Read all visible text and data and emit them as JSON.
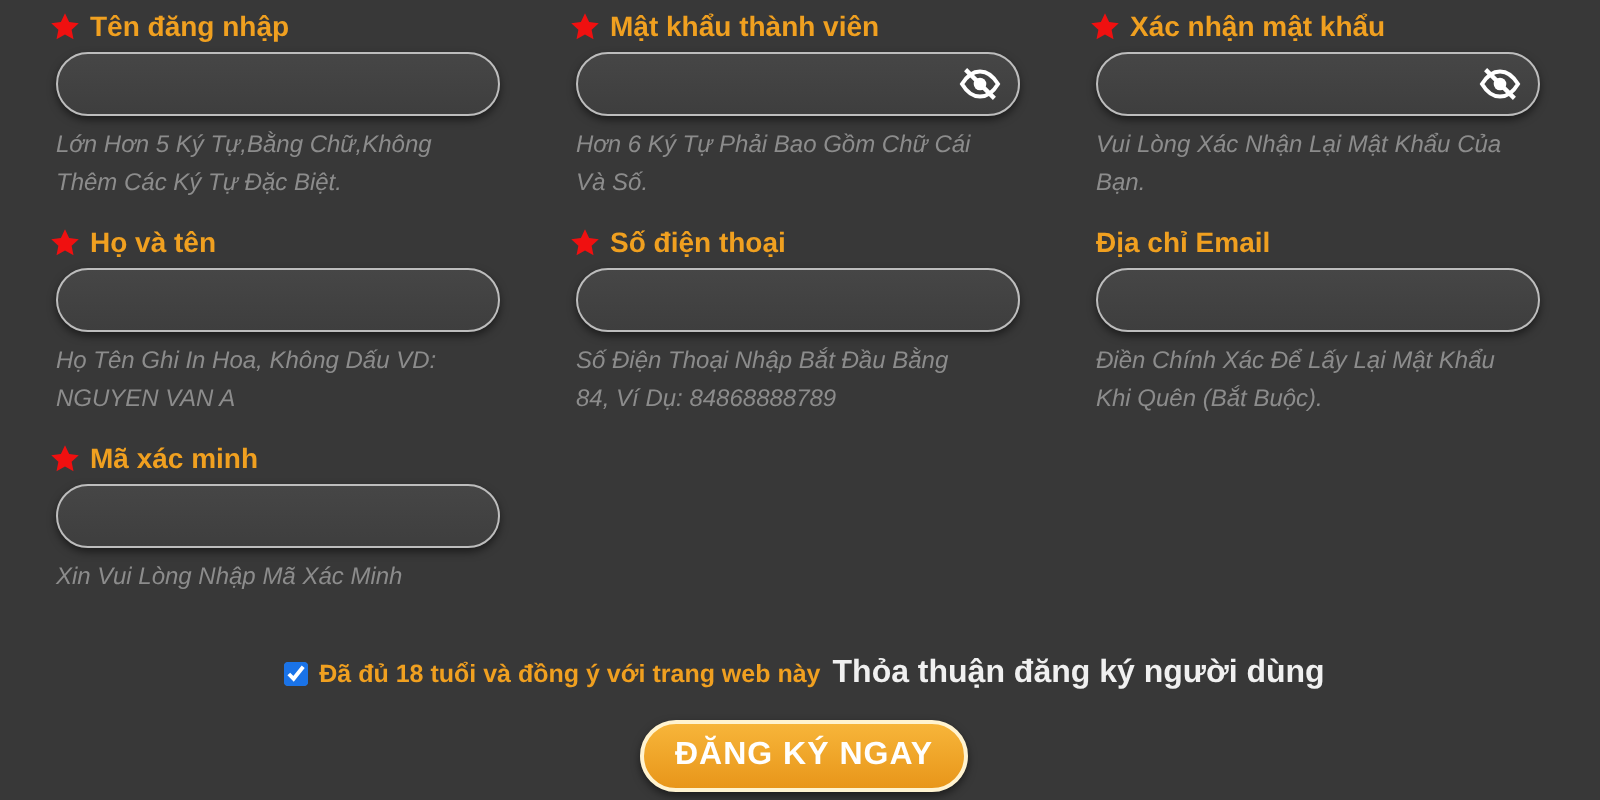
{
  "fields": [
    {
      "label": "Tên đăng nhập",
      "required": true,
      "kind": "text",
      "hint": "Lớn Hơn 5 Ký Tự,Bằng Chữ,Không Thêm Các Ký Tự Đặc Biệt."
    },
    {
      "label": "Mật khẩu thành viên",
      "required": true,
      "kind": "password",
      "hint": "Hơn 6 Ký Tự Phải Bao Gồm Chữ Cái Và Số."
    },
    {
      "label": "Xác nhận mật khẩu",
      "required": true,
      "kind": "password",
      "hint": "Vui Lòng Xác Nhận Lại Mật Khẩu Của Bạn."
    },
    {
      "label": "Họ và tên",
      "required": true,
      "kind": "text",
      "hint": "Họ Tên Ghi In Hoa, Không Dấu VD: NGUYEN VAN A"
    },
    {
      "label": "Số điện thoại",
      "required": true,
      "kind": "text",
      "hint": "Số Điện Thoại Nhập Bắt Đầu Bằng 84, Ví Dụ: 84868888789"
    },
    {
      "label": "Địa chỉ Email",
      "required": false,
      "kind": "text",
      "hint": "Điền Chính Xác Để Lấy Lại Mật Khẩu Khi Quên (Bắt Buộc)."
    },
    {
      "label": "Mã xác minh",
      "required": true,
      "kind": "text",
      "hint": "Xin Vui Lòng Nhập Mã Xác Minh"
    }
  ],
  "agreement": {
    "checked": true,
    "text": "Đã đủ 18 tuổi và đồng ý với trang web này",
    "link": "Thỏa thuận đăng ký người dùng"
  },
  "submit": "ĐĂNG KÝ NGAY"
}
